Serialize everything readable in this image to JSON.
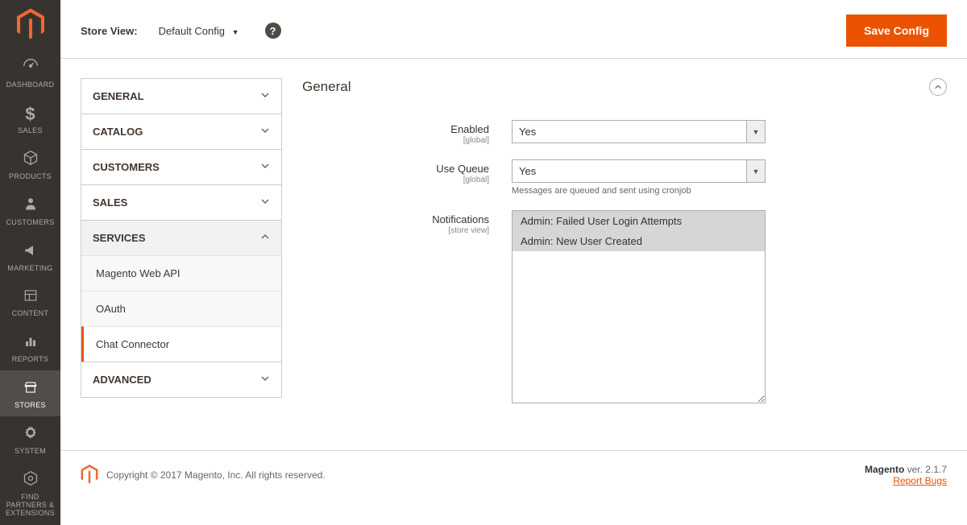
{
  "sidebar": {
    "items": [
      {
        "label": "DASHBOARD"
      },
      {
        "label": "SALES"
      },
      {
        "label": "PRODUCTS"
      },
      {
        "label": "CUSTOMERS"
      },
      {
        "label": "MARKETING"
      },
      {
        "label": "CONTENT"
      },
      {
        "label": "REPORTS"
      },
      {
        "label": "STORES"
      },
      {
        "label": "SYSTEM"
      },
      {
        "label": "FIND PARTNERS & EXTENSIONS"
      }
    ]
  },
  "topbar": {
    "store_view_label": "Store View:",
    "store_view_value": "Default Config",
    "save_button": "Save Config"
  },
  "config_nav": {
    "sections": [
      {
        "label": "GENERAL",
        "expanded": false
      },
      {
        "label": "CATALOG",
        "expanded": false
      },
      {
        "label": "CUSTOMERS",
        "expanded": false
      },
      {
        "label": "SALES",
        "expanded": false
      },
      {
        "label": "SERVICES",
        "expanded": true,
        "items": [
          {
            "label": "Magento Web API",
            "active": false
          },
          {
            "label": "OAuth",
            "active": false
          },
          {
            "label": "Chat Connector",
            "active": true
          }
        ]
      },
      {
        "label": "ADVANCED",
        "expanded": false
      }
    ]
  },
  "panel": {
    "title": "General",
    "fields": {
      "enabled": {
        "label": "Enabled",
        "scope": "[global]",
        "value": "Yes"
      },
      "use_queue": {
        "label": "Use Queue",
        "scope": "[global]",
        "value": "Yes",
        "note": "Messages are queued and sent using cronjob"
      },
      "notifications": {
        "label": "Notifications",
        "scope": "[store view]",
        "options": [
          "Admin: Failed User Login Attempts",
          "Admin: New User Created"
        ]
      }
    }
  },
  "footer": {
    "copyright": "Copyright © 2017 Magento, Inc. All rights reserved.",
    "version_prefix": "Magento",
    "version": " ver. 2.1.7",
    "report_bugs": "Report Bugs"
  }
}
